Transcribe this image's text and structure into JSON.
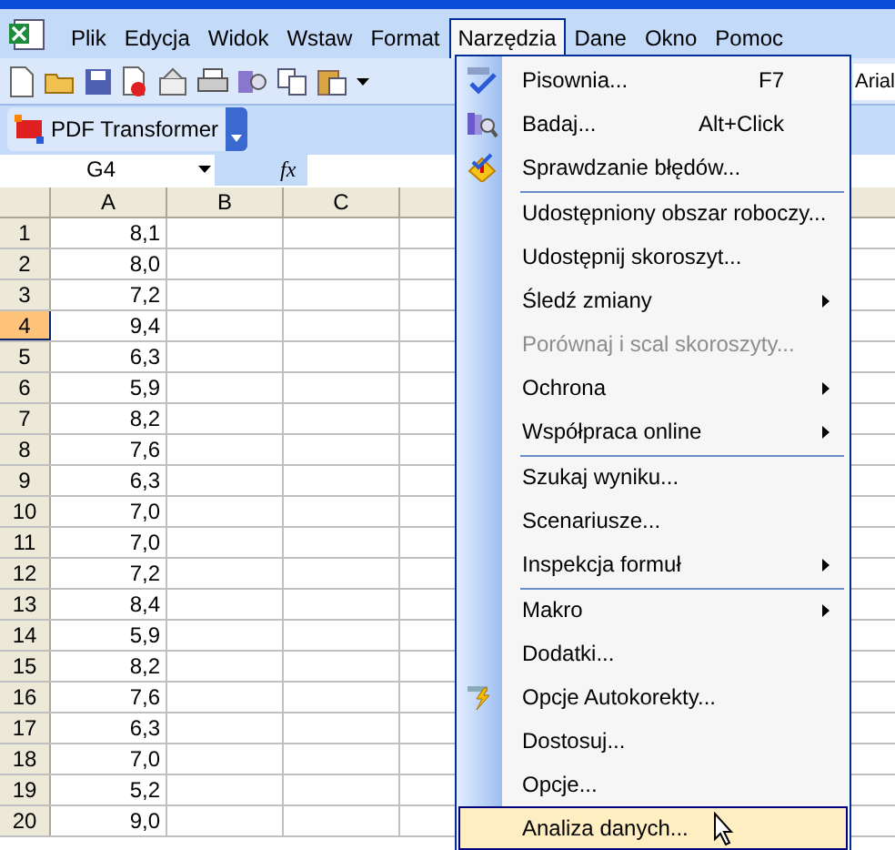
{
  "menu_bar": {
    "items": [
      {
        "label": "Plik",
        "selected": false
      },
      {
        "label": "Edycja",
        "selected": false
      },
      {
        "label": "Widok",
        "selected": false
      },
      {
        "label": "Wstaw",
        "selected": false
      },
      {
        "label": "Format",
        "selected": false
      },
      {
        "label": "Narzędzia",
        "selected": true
      },
      {
        "label": "Dane",
        "selected": false
      },
      {
        "label": "Okno",
        "selected": false
      },
      {
        "label": "Pomoc",
        "selected": false
      }
    ]
  },
  "toolbar": {
    "font_field": "Arial"
  },
  "pdf_toolbar": {
    "label": "PDF Transformer"
  },
  "formula_bar": {
    "name_box": "G4",
    "fx": "fx"
  },
  "sheet": {
    "columns": [
      "A",
      "B",
      "C"
    ],
    "rows": [
      {
        "header": "1",
        "a": "8,1",
        "selected": false
      },
      {
        "header": "2",
        "a": "8,0",
        "selected": false
      },
      {
        "header": "3",
        "a": "7,2",
        "selected": false
      },
      {
        "header": "4",
        "a": "9,4",
        "selected": true
      },
      {
        "header": "5",
        "a": "6,3",
        "selected": false
      },
      {
        "header": "6",
        "a": "5,9",
        "selected": false
      },
      {
        "header": "7",
        "a": "8,2",
        "selected": false
      },
      {
        "header": "8",
        "a": "7,6",
        "selected": false
      },
      {
        "header": "9",
        "a": "6,3",
        "selected": false
      },
      {
        "header": "10",
        "a": "7,0",
        "selected": false
      },
      {
        "header": "11",
        "a": "7,0",
        "selected": false
      },
      {
        "header": "12",
        "a": "7,2",
        "selected": false
      },
      {
        "header": "13",
        "a": "8,4",
        "selected": false
      },
      {
        "header": "14",
        "a": "5,9",
        "selected": false
      },
      {
        "header": "15",
        "a": "8,2",
        "selected": false
      },
      {
        "header": "16",
        "a": "7,6",
        "selected": false
      },
      {
        "header": "17",
        "a": "6,3",
        "selected": false
      },
      {
        "header": "18",
        "a": "7,0",
        "selected": false
      },
      {
        "header": "19",
        "a": "5,2",
        "selected": false
      },
      {
        "header": "20",
        "a": "9,0",
        "selected": false
      }
    ]
  },
  "tools_menu": {
    "items": [
      {
        "label": "Pisownia...",
        "kind": "spelling",
        "shortcut": "F7",
        "submenu": false,
        "disabled": false,
        "separator_before": false,
        "selected": false
      },
      {
        "label": "Badaj...",
        "kind": "research",
        "shortcut": "Alt+Click",
        "submenu": false,
        "disabled": false,
        "separator_before": false,
        "selected": false
      },
      {
        "label": "Sprawdzanie błędów...",
        "kind": "error",
        "submenu": false,
        "disabled": false,
        "separator_before": false,
        "selected": false
      },
      {
        "label": "Udostępniony obszar roboczy...",
        "submenu": false,
        "disabled": false,
        "separator_before": true,
        "selected": false
      },
      {
        "label": "Udostępnij skoroszyt...",
        "submenu": false,
        "disabled": false,
        "separator_before": false,
        "selected": false
      },
      {
        "label": "Śledź zmiany",
        "submenu": true,
        "disabled": false,
        "separator_before": false,
        "selected": false
      },
      {
        "label": "Porównaj i scal skoroszyty...",
        "submenu": false,
        "disabled": true,
        "separator_before": false,
        "selected": false
      },
      {
        "label": "Ochrona",
        "submenu": true,
        "disabled": false,
        "separator_before": false,
        "selected": false
      },
      {
        "label": "Współpraca online",
        "submenu": true,
        "disabled": false,
        "separator_before": false,
        "selected": false
      },
      {
        "label": "Szukaj wyniku...",
        "submenu": false,
        "disabled": false,
        "separator_before": true,
        "selected": false
      },
      {
        "label": "Scenariusze...",
        "submenu": false,
        "disabled": false,
        "separator_before": false,
        "selected": false
      },
      {
        "label": "Inspekcja formuł",
        "submenu": true,
        "disabled": false,
        "separator_before": false,
        "selected": false
      },
      {
        "label": "Makro",
        "submenu": true,
        "disabled": false,
        "separator_before": true,
        "selected": false
      },
      {
        "label": "Dodatki...",
        "submenu": false,
        "disabled": false,
        "separator_before": false,
        "selected": false
      },
      {
        "label": "Opcje Autokorekty...",
        "kind": "autocorrect",
        "submenu": false,
        "disabled": false,
        "separator_before": false,
        "selected": false
      },
      {
        "label": "Dostosuj...",
        "submenu": false,
        "disabled": false,
        "separator_before": false,
        "selected": false
      },
      {
        "label": "Opcje...",
        "submenu": false,
        "disabled": false,
        "separator_before": false,
        "selected": false
      },
      {
        "label": "Analiza danych...",
        "submenu": false,
        "disabled": false,
        "separator_before": false,
        "selected": true
      }
    ]
  }
}
